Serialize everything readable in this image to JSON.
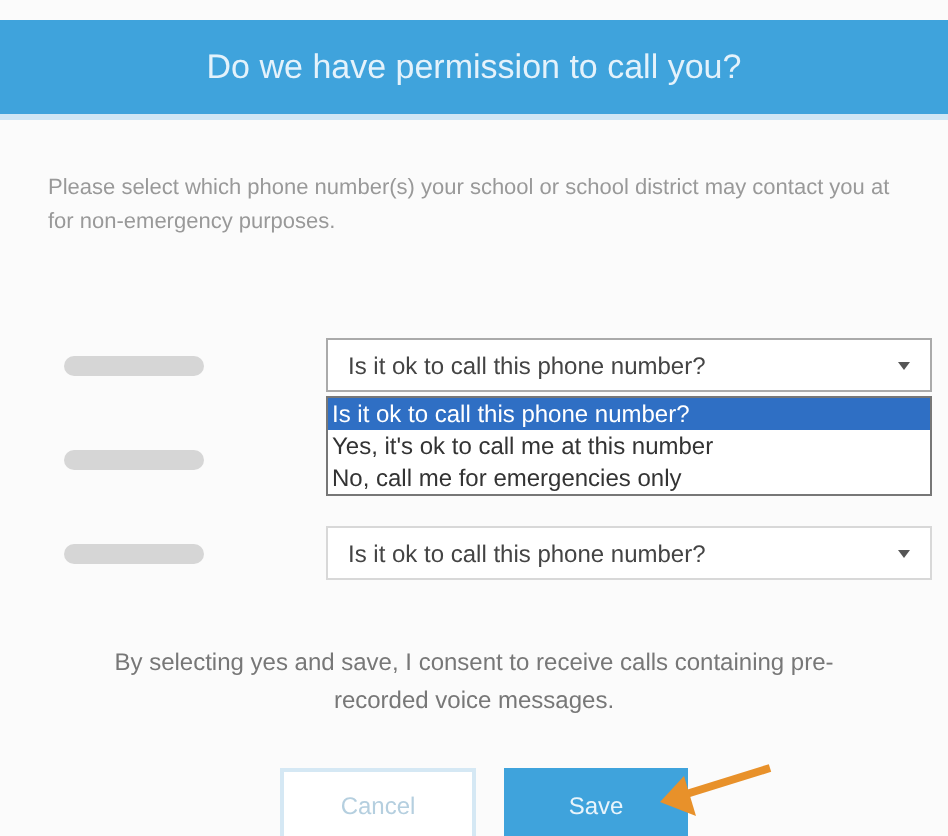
{
  "dialog": {
    "title": "Do we have permission to call you?"
  },
  "instructions": "Please select which phone number(s) your school or school district may contact you at for non-emergency purposes.",
  "phone_rows": [
    {
      "kind": "select",
      "value": "Is it ok to call this phone number?",
      "expanded": true,
      "options": [
        {
          "label": "Is it ok to call this phone number?",
          "selected": true
        },
        {
          "label": "Yes, it's ok to call me at this number",
          "selected": false
        },
        {
          "label": "No, call me for emergencies only",
          "selected": false
        }
      ]
    },
    {
      "kind": "covered"
    },
    {
      "kind": "select",
      "value": "Is it ok to call this phone number?",
      "expanded": false
    }
  ],
  "consent": "By selecting yes and save, I consent to receive calls containing pre-recorded voice messages.",
  "buttons": [
    {
      "label": "Cancel",
      "kind": "secondary"
    },
    {
      "label": "Save",
      "kind": "primary"
    }
  ],
  "annotation": {
    "kind": "arrow"
  }
}
